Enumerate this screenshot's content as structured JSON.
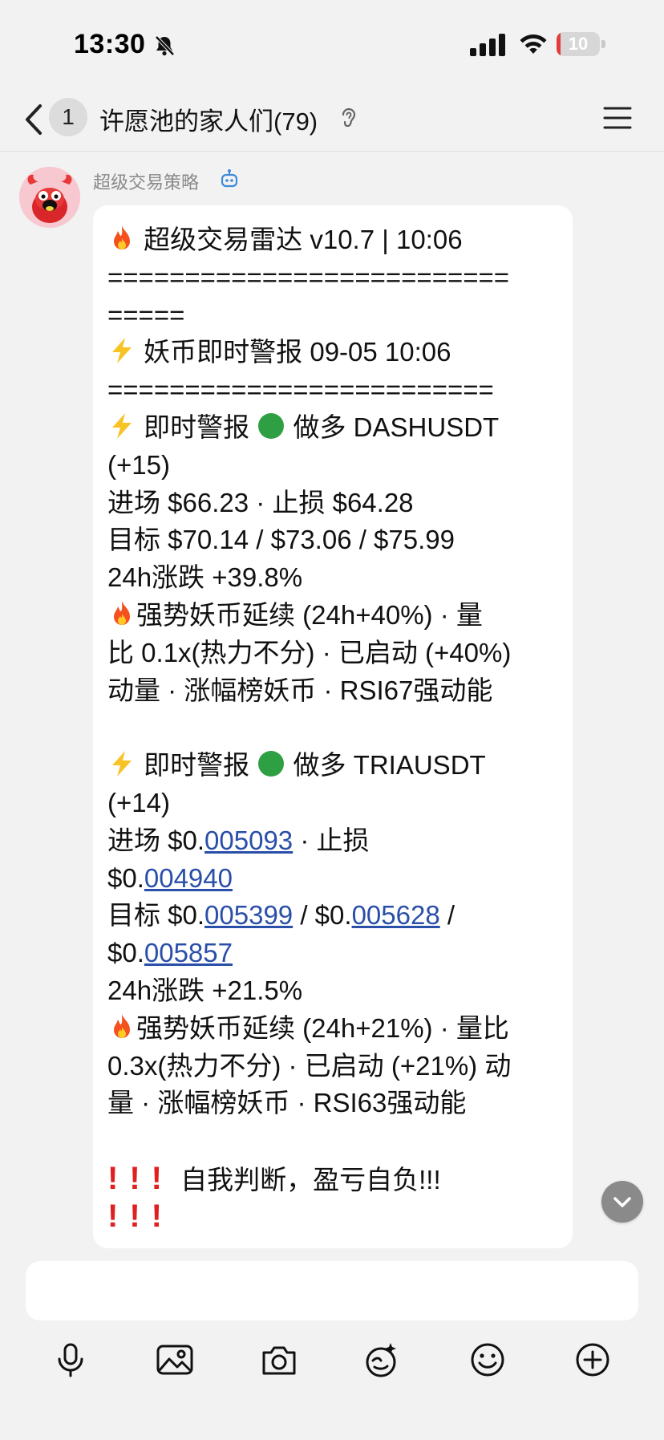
{
  "status_bar": {
    "time": "13:30",
    "battery": "10",
    "battery_level": 0.1
  },
  "nav": {
    "unread_count": "1",
    "title": "许愿池的家人们(79)"
  },
  "message": {
    "sender": "超级交易策略",
    "lines": [
      "超级交易雷达 v10.7 | 10:06",
      "==========================",
      "=====",
      "妖币即时警报 09-05 10:06",
      "=========================",
      "即时警报",
      "做多 DASHUSDT",
      "(+15)",
      "进场 $66.23 · 止损 $64.28",
      "目标 $70.14 / $73.06 / $75.99",
      "24h涨跌 +39.8%",
      "强势妖币延续 (24h+40%) · 量",
      "比 0.1x(热力不分) · 已启动 (+40%)",
      "动量 · 涨幅榜妖币 · RSI67强动能",
      "即时警报",
      "做多 TRIAUSDT",
      "(+14)",
      "进场 $0.",
      "005093",
      " · 止损",
      "$0.",
      "004940",
      "目标 $0.",
      "005399",
      " / $0.",
      "005628",
      " /",
      "$0.",
      "005857",
      "24h涨跌 +21.5%",
      "强势妖币延续 (24h+21%) · 量比",
      " 0.3x(热力不分) · 已启动 (+21%) 动",
      "量 · 涨幅榜妖币 · RSI63强动能",
      "!!!",
      "自我判断，盈亏自负!!!",
      "!!!"
    ]
  },
  "icons": {
    "toolbar": [
      "microphone-icon",
      "image-icon",
      "camera-icon",
      "sticker-icon",
      "emoji-icon",
      "plus-icon"
    ]
  },
  "colors": {
    "link": "#2a4fa8",
    "battery_low": "#e43b3b",
    "exclamation": "#e02020",
    "long_dot": "#2ea043"
  }
}
